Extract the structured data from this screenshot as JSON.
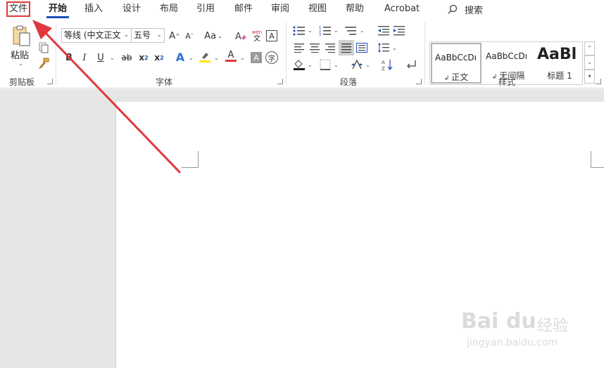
{
  "menu": {
    "file": "文件",
    "tabs": [
      "开始",
      "插入",
      "设计",
      "布局",
      "引用",
      "邮件",
      "审阅",
      "视图",
      "帮助",
      "Acrobat"
    ],
    "active_tab_index": 0,
    "search_label": "搜索"
  },
  "clipboard": {
    "paste_label": "粘贴",
    "group_label": "剪贴板"
  },
  "font": {
    "font_name": "等线 (中文正文",
    "font_size": "五号",
    "grow_label": "A",
    "shrink_label": "A",
    "case_label": "Aa",
    "phonetic_top": "wén",
    "phonetic_bottom": "文",
    "border_char": "A",
    "bold": "B",
    "italic": "I",
    "underline": "U",
    "strike": "ab",
    "subscript": "x",
    "superscript": "x",
    "sub_index": "2",
    "sup_index": "2",
    "effects": "A",
    "font_color": "A",
    "char_shading": "A",
    "enclose": "字",
    "group_label": "字体"
  },
  "paragraph": {
    "group_label": "段落"
  },
  "styles": {
    "items": [
      {
        "sample": "AaBbCcDı",
        "name": "正文"
      },
      {
        "sample": "AaBbCcDı",
        "name": "无间隔"
      },
      {
        "sample": "AaBl",
        "name": "标题 1"
      }
    ],
    "group_label": "样式"
  },
  "watermark": {
    "main": "Bai du",
    "cn": "经验",
    "sub": "jingyan.baidu.com"
  },
  "colors": {
    "highlight_annotation": "#e0383c",
    "active_tab_underline": "#1f4fb5",
    "highlighter": "#ffe600",
    "font_color_bar": "#e0383c",
    "workspace_bg": "#e6e6e6"
  }
}
